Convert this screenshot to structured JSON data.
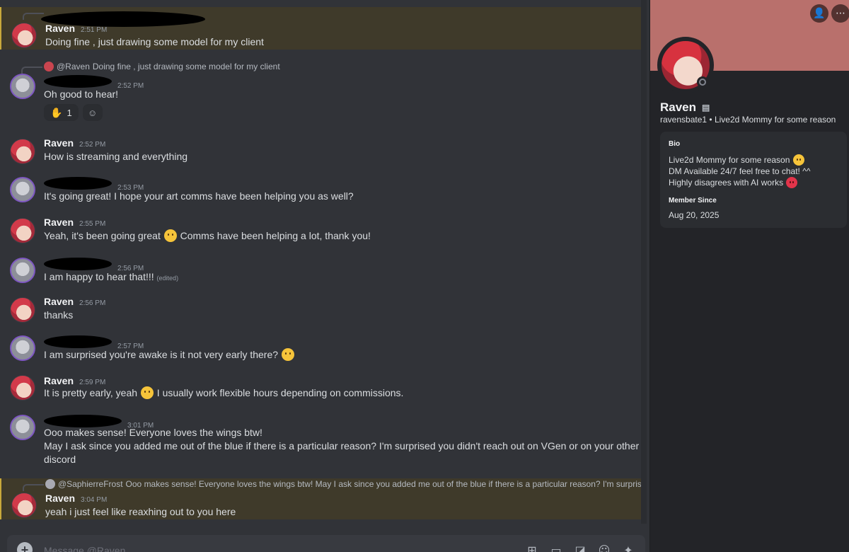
{
  "messages": [
    {
      "author": "Raven",
      "time": "2:51 PM",
      "text": "Doing fine , just drawing some model for my client"
    },
    {
      "reply_author": "@Raven",
      "reply_text": "Doing fine , just drawing some model for my client",
      "time": "2:52 PM",
      "text": "Oh good to hear!",
      "reaction_count": "1"
    },
    {
      "author": "Raven",
      "time": "2:52 PM",
      "text": "How is streaming and everything"
    },
    {
      "time": "2:53 PM",
      "text": "It's going great! I hope your art comms have been helping you as well?"
    },
    {
      "author": "Raven",
      "time": "2:55 PM",
      "text_before": "Yeah, it's been going great",
      "text_after": "Comms have been helping a lot, thank you!"
    },
    {
      "time": "2:56 PM",
      "text": "I am happy to hear that!!!",
      "edited": "(edited)"
    },
    {
      "author": "Raven",
      "time": "2:56 PM",
      "text": "thanks"
    },
    {
      "time": "2:57 PM",
      "text": "I am surprised you're awake is it not very early there?"
    },
    {
      "author": "Raven",
      "time": "2:59 PM",
      "text_before": "It is pretty early, yeah",
      "text_after": "I usually work flexible hours depending on commissions."
    },
    {
      "time": "3:01 PM",
      "line1": "Ooo makes sense! Everyone loves the wings btw!",
      "line2": "May I ask since you added me out of the blue if there is a particular reason? I'm surprised you didn't reach out on VGen or on your other",
      "line3": "discord"
    },
    {
      "author": "Raven",
      "reply_author": "@SaphierreFrost",
      "reply_text": "Ooo makes sense! Everyone loves the wings btw!  May I ask since you added me out of the blue if there is a particular reason? I'm surprised ...",
      "time": "3:04 PM",
      "text": "yeah i just feel like reaxhing out to you here"
    }
  ],
  "composer": {
    "placeholder": "Message @Raven"
  },
  "profile": {
    "name": "Raven",
    "username": "ravensbate1",
    "separator": "•",
    "tagline": "Live2d Mommy for some reason",
    "bio_heading": "Bio",
    "bio_line1": "Live2d Mommy for some reason",
    "bio_line2": "DM Available 24/7 feel free to chat! ^^",
    "bio_line3": "Highly disagrees with AI works",
    "member_since_heading": "Member Since",
    "member_since": "Aug 20, 2025"
  },
  "colors": {
    "highlight": "#3f3a2a",
    "accent": "#c9a93b",
    "banner": "#b9706c"
  }
}
